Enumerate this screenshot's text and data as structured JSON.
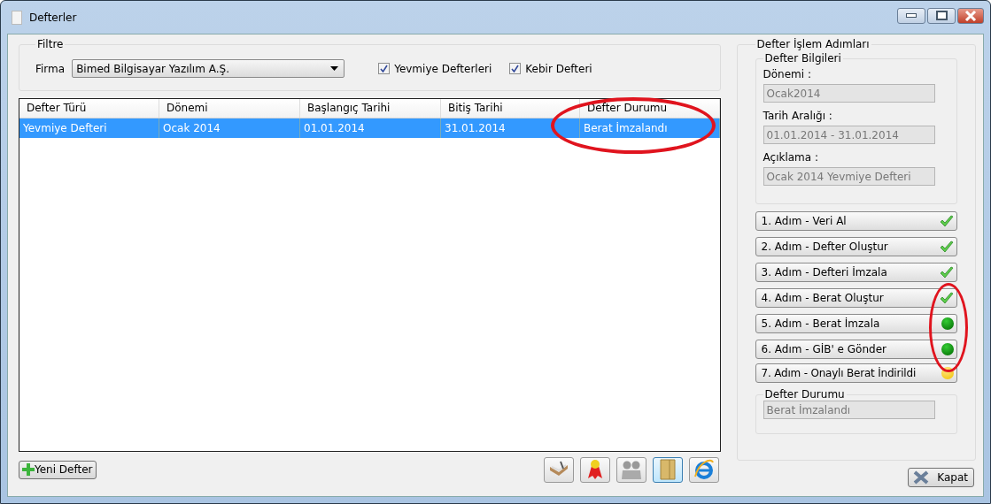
{
  "window": {
    "title": "Defterler"
  },
  "filter": {
    "legend": "Filtre",
    "firma_label": "Firma",
    "firma_value": "Bimed Bilgisayar Yazılım A.Ş.",
    "checkboxes": [
      {
        "label": "Yevmiye Defterleri",
        "checked": true
      },
      {
        "label": "Kebir Defteri",
        "checked": true
      }
    ]
  },
  "table": {
    "columns": [
      {
        "label": "Defter Türü",
        "circled": false
      },
      {
        "label": "Dönemi",
        "circled": false
      },
      {
        "label": "Başlangıç Tarihi",
        "circled": false
      },
      {
        "label": "Bitiş Tarihi",
        "circled": false
      },
      {
        "label": "Defter Durumu",
        "circled": true
      }
    ],
    "rows": [
      {
        "cells": [
          "Yevmiye Defteri",
          "Ocak 2014",
          "01.01.2014",
          "31.01.2014",
          "Berat İmzalandı"
        ],
        "selected": true
      }
    ]
  },
  "new_button": "Yeni Defter",
  "panel": {
    "legend": "Defter İşlem Adımları",
    "info_legend": "Defter Bilgileri",
    "fields": [
      {
        "label": "Dönemi :",
        "value": "Ocak2014"
      },
      {
        "label": "Tarih Aralığı :",
        "value": "01.01.2014 - 31.01.2014"
      },
      {
        "label": "Açıklama :",
        "value": "Ocak 2014 Yevmiye Defteri"
      }
    ],
    "steps": [
      {
        "label": "1. Adım - Veri Al",
        "kind": "done",
        "circled": false
      },
      {
        "label": "2. Adım - Defter Oluştur",
        "kind": "done",
        "circled": false
      },
      {
        "label": "3. Adım - Defteri İmzala",
        "kind": "done",
        "circled": false
      },
      {
        "label": "4. Adım - Berat Oluştur",
        "kind": "done",
        "circled": true
      },
      {
        "label": "5. Adım - Berat İmzala",
        "kind": "green",
        "circled": true
      },
      {
        "label": "6. Adım - GİB' e Gönder",
        "kind": "green",
        "circled": true
      },
      {
        "label": "7. Adım - Onaylı Berat İndirildi",
        "kind": "yellow",
        "circled": false
      }
    ],
    "status_legend": "Defter Durumu",
    "status_value": "Berat İmzalandı"
  },
  "close_button": "Kapat"
}
